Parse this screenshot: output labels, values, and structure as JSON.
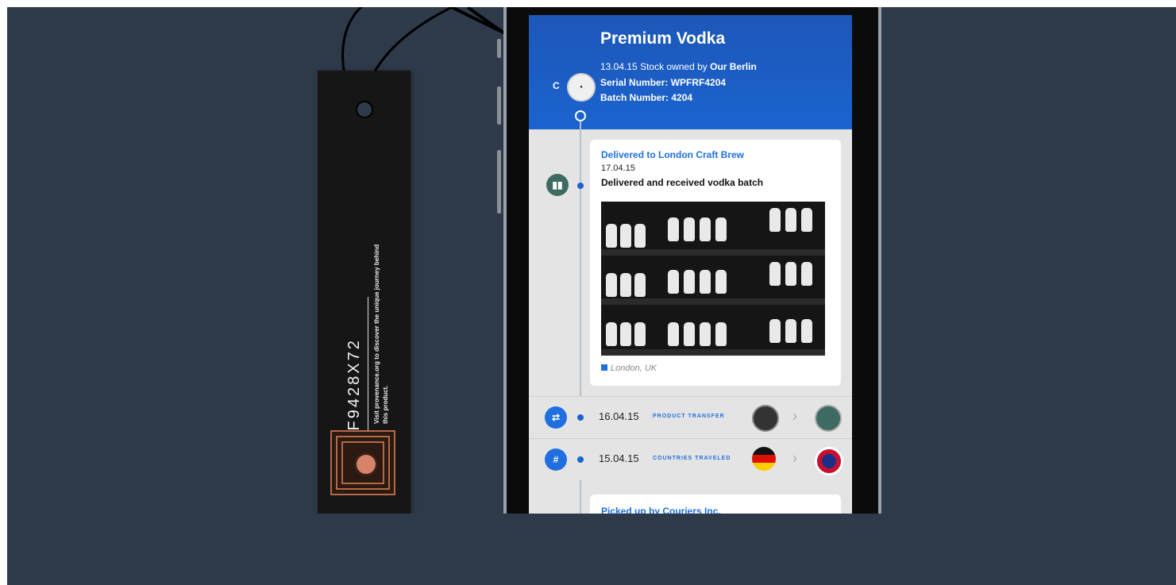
{
  "tag": {
    "code": "FBF9428X72",
    "visit_text": "Visit provenance.org to discover the unique journey behind this product."
  },
  "header": {
    "title": "Premium Vodka",
    "stock_date": "13.04.15",
    "stock_text": "Stock owned by",
    "stock_owner": "Our Berlin",
    "serial": "Serial Number: WPFRF4204",
    "batch": "Batch Number: 4204",
    "c_label": "C"
  },
  "event": {
    "title": "Delivered to London Craft Brew",
    "date": "17.04.15",
    "description": "Delivered and received vodka batch",
    "location": "London, UK"
  },
  "rows": [
    {
      "date": "16.04.15",
      "type": "PRODUCT TRANSFER"
    },
    {
      "date": "15.04.15",
      "type": "COUNTRIES TRAVELED"
    }
  ],
  "next_event": {
    "title": "Picked up by Couriers Inc."
  },
  "colors": {
    "accent": "#1f6fe0",
    "header": "#1b63cf",
    "background": "#2e3a4a"
  }
}
